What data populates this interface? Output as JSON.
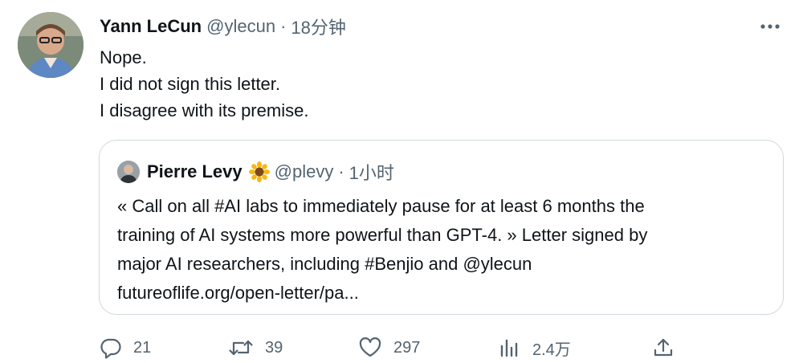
{
  "tweet": {
    "author_name": "Yann LeCun",
    "author_handle": "@ylecun",
    "separator": "·",
    "time": "18分钟",
    "lines": [
      "Nope.",
      "I did not sign this letter.",
      "I disagree with its premise."
    ]
  },
  "quoted": {
    "author_name": "Pierre Levy",
    "author_emoji": "sunflower",
    "author_handle": "@plevy",
    "separator": "·",
    "time": "1小时",
    "lines": [
      "« Call on all #AI labs to immediately pause for at least 6 months the",
      "training of AI systems more powerful than GPT-4. » Letter signed by",
      "major AI researchers, including #Benjio and @ylecun",
      "futureoflife.org/open-letter/pa..."
    ]
  },
  "actions": {
    "reply_count": "21",
    "retweet_count": "39",
    "like_count": "297",
    "views_count": "2.4万"
  },
  "colors": {
    "text": "#0f1419",
    "muted": "#536471",
    "border": "#cfd9de"
  },
  "icons": [
    "more-icon",
    "reply-icon",
    "retweet-icon",
    "like-icon",
    "views-icon",
    "share-icon"
  ]
}
